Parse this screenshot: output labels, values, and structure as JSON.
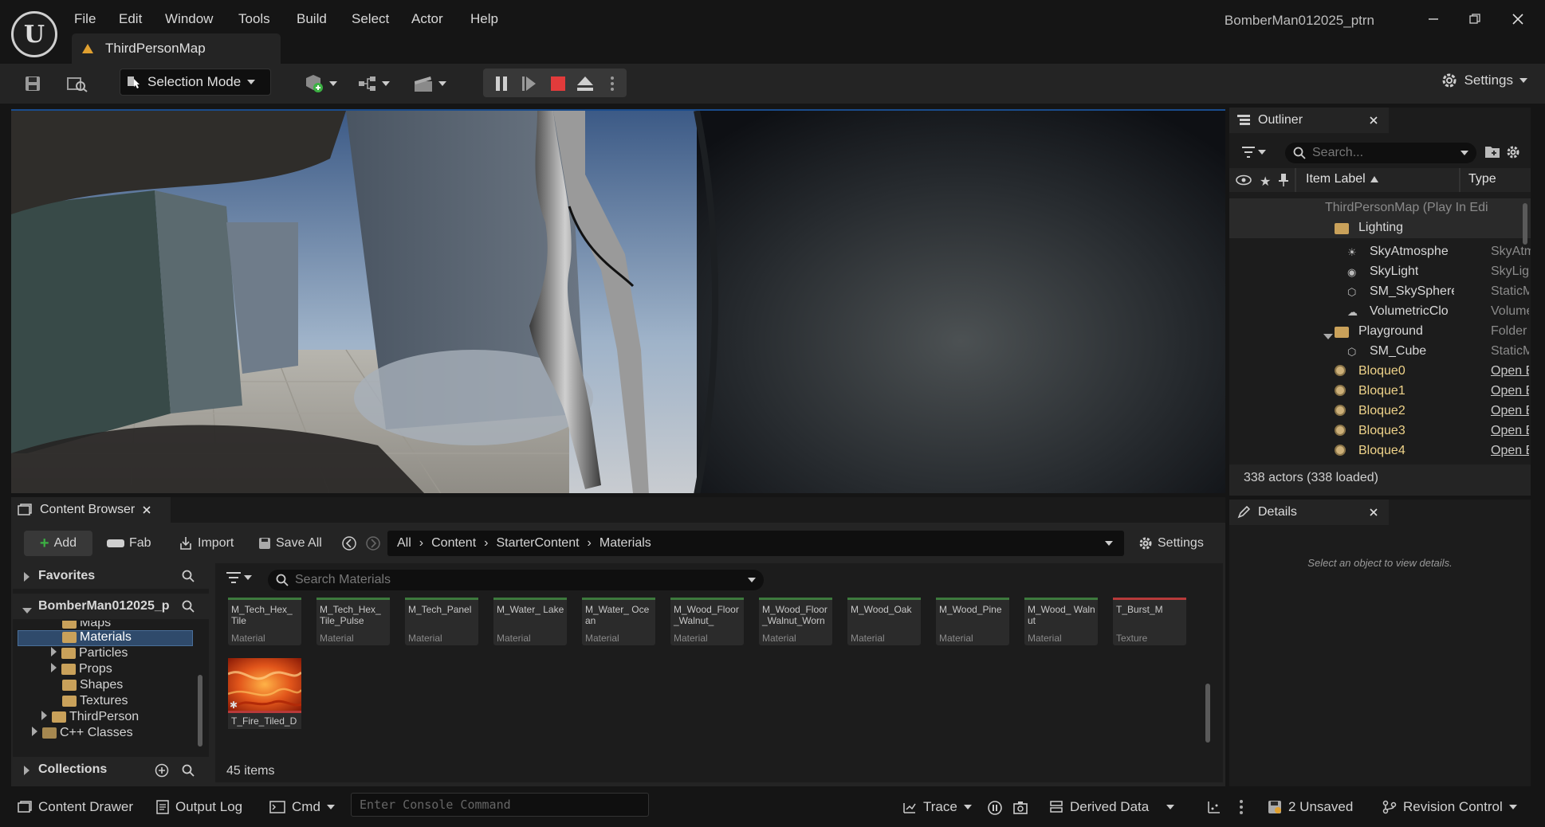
{
  "app": {
    "logo": "U",
    "title": "BomberMan012025_ptrn",
    "map_tab": "ThirdPersonMap",
    "menu": [
      "File",
      "Edit",
      "Window",
      "Tools",
      "Build",
      "Select",
      "Actor",
      "Help"
    ]
  },
  "toolbar": {
    "selection_mode": "Selection Mode",
    "settings": "Settings"
  },
  "outliner": {
    "tab": "Outliner",
    "search_placeholder": "Search...",
    "col_label": "Item Label",
    "col_type": "Type",
    "rows": [
      {
        "label": "ThirdPersonMap (Play In Edi",
        "type": ""
      },
      {
        "label": "Lighting",
        "type": ""
      },
      {
        "label": "SkyAtmosphe",
        "type": "SkyAtmo"
      },
      {
        "label": "SkyLight",
        "type": "SkyLight"
      },
      {
        "label": "SM_SkySphere",
        "type": "StaticMe"
      },
      {
        "label": "VolumetricClo",
        "type": "Volumetr"
      },
      {
        "label": "Playground",
        "type": "Folder"
      },
      {
        "label": "SM_Cube",
        "type": "StaticMe"
      },
      {
        "label": "Bloque0",
        "type": "Open Blo"
      },
      {
        "label": "Bloque1",
        "type": "Open Blo"
      },
      {
        "label": "Bloque2",
        "type": "Open Blo"
      },
      {
        "label": "Bloque3",
        "type": "Open Blo"
      },
      {
        "label": "Bloque4",
        "type": "Open Blo"
      }
    ],
    "footer": "338 actors (338 loaded)"
  },
  "details": {
    "tab": "Details",
    "empty": "Select an object to view details."
  },
  "content_browser": {
    "tab": "Content Browser",
    "add": "Add",
    "fab": "Fab",
    "import": "Import",
    "save_all": "Save All",
    "path": [
      "All",
      "Content",
      "StarterContent",
      "Materials"
    ],
    "settings": "Settings",
    "favorites": "Favorites",
    "project": "BomberMan012025_p",
    "collections": "Collections",
    "search_placeholder": "Search Materials",
    "tree": [
      {
        "label": "Maps"
      },
      {
        "label": "Materials"
      },
      {
        "label": "Particles"
      },
      {
        "label": "Props"
      },
      {
        "label": "Shapes"
      },
      {
        "label": "Textures"
      },
      {
        "label": "ThirdPerson"
      },
      {
        "label": "C++ Classes"
      }
    ],
    "assets": [
      {
        "name": "M_Tech_Hex_ Tile",
        "type": "Material"
      },
      {
        "name": "M_Tech_Hex_ Tile_Pulse",
        "type": "Material"
      },
      {
        "name": "M_Tech_Panel",
        "type": "Material"
      },
      {
        "name": "M_Water_ Lake",
        "type": "Material"
      },
      {
        "name": "M_Water_ Ocean",
        "type": "Material"
      },
      {
        "name": "M_Wood_Floor _Walnut_",
        "type": "Material"
      },
      {
        "name": "M_Wood_Floor _Walnut_Worn",
        "type": "Material"
      },
      {
        "name": "M_Wood_Oak",
        "type": "Material"
      },
      {
        "name": "M_Wood_Pine",
        "type": "Material"
      },
      {
        "name": "M_Wood_ Walnut",
        "type": "Material"
      },
      {
        "name": "T_Burst_M",
        "type": "Texture"
      }
    ],
    "texture_asset": "T_Fire_Tiled_D",
    "item_count": "45 items"
  },
  "statusbar": {
    "content_drawer": "Content Drawer",
    "output_log": "Output Log",
    "cmd": "Cmd",
    "console_placeholder": "Enter Console Command",
    "trace": "Trace",
    "derived_data": "Derived Data",
    "unsaved": "2 Unsaved",
    "revision_control": "Revision Control"
  },
  "colors": {
    "accent_selection": "#2f4a6b",
    "play_stop": "#e23b3b",
    "folder": "#c9a15a"
  }
}
